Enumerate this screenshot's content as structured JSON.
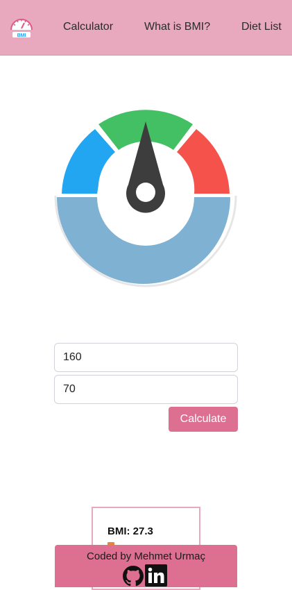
{
  "brand": {
    "logo_icon": "bmi-gauge-logo-icon",
    "logo_text": "BMI"
  },
  "nav": {
    "items": [
      {
        "label": "Calculator"
      },
      {
        "label": "What is BMI?"
      },
      {
        "label": "Diet List"
      }
    ]
  },
  "gauge": {
    "icon": "bmi-gauge-icon",
    "colors": {
      "underweight": "#22a6f2",
      "normal": "#43bf64",
      "overweight": "#f5524b",
      "base": "#7fb1d2",
      "needle": "#3d3d3d"
    }
  },
  "form": {
    "height_value": "160",
    "weight_value": "70",
    "calculate_label": "Calculate"
  },
  "result": {
    "bmi_text": "BMI: 27.3"
  },
  "footer": {
    "credit": "Coded by Mehmet Urmaç",
    "github_icon": "github-icon",
    "linkedin_icon": "linkedin-icon"
  },
  "colors": {
    "navbar": "#e8a9bf",
    "accent": "#dd7091"
  }
}
